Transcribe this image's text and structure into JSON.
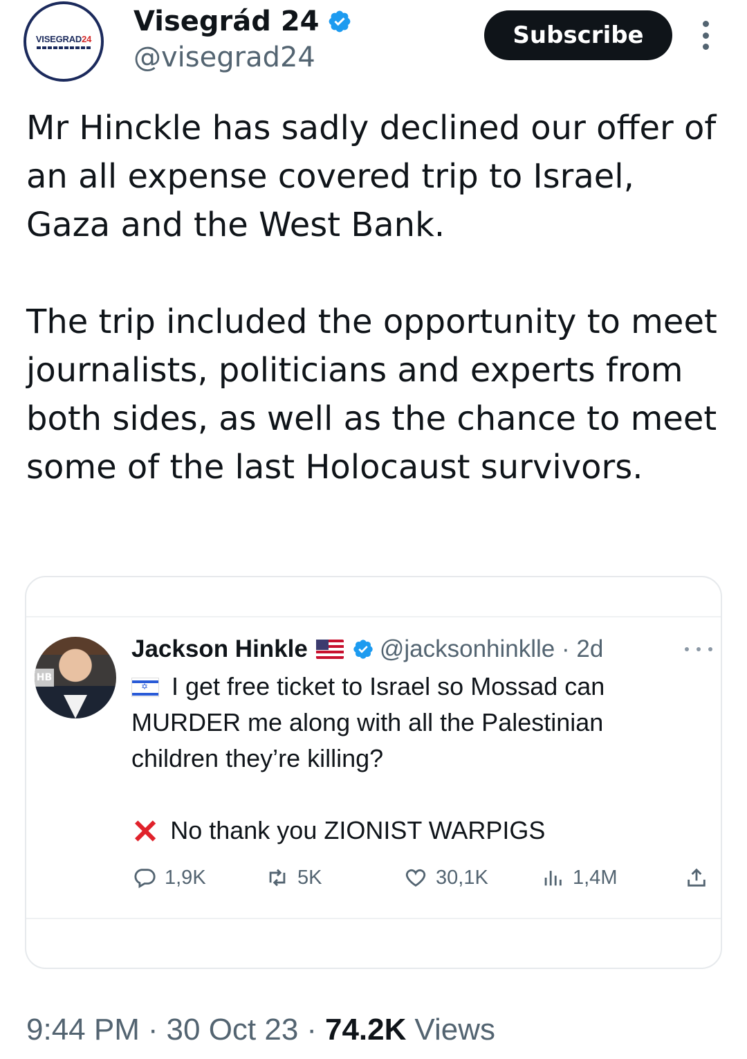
{
  "author": {
    "display_name": "Visegrád 24",
    "handle": "@visegrad24",
    "avatar_logo_text": "VISEGRAD",
    "avatar_logo_num": "24",
    "verified_icon": "verified-badge-icon",
    "verified_color": "#1d9bf0"
  },
  "header": {
    "subscribe_label": "Subscribe",
    "more_icon": "more-vertical-icon"
  },
  "tweet": {
    "paragraphs": [
      "Mr Hinckle has sadly declined our offer of an all expense covered trip to Israel, Gaza and the West Bank.",
      "The trip included the opportunity to meet journalists, politicians and experts from both sides, as well as the chance to meet some of the last Holocaust survivors."
    ]
  },
  "quote": {
    "author_name": "Jackson Hinkle",
    "author_flag_icon": "us-flag-icon",
    "handle_time": "@jacksonhinklle · 2d",
    "avatar_overlay_text": "HB",
    "text_line1": "I get free ticket to Israel so Mossad can MURDER me along with all the Palestinian children they’re killing?",
    "text_line2": "No thank you ZIONIST WARPIGS",
    "text_line1_flag_icon": "israel-flag-icon",
    "text_line2_icon": "red-x-mark-icon",
    "actions": {
      "replies": "1,9K",
      "reposts": "5K",
      "likes": "30,1K",
      "views": "1,4M"
    }
  },
  "footer": {
    "time": "9:44 PM",
    "date": "30 Oct 23",
    "views_count": "74.2K",
    "views_label": "Views",
    "separator": "·"
  },
  "colors": {
    "text_primary": "#0f1419",
    "text_secondary": "#536471",
    "accent_blue": "#1d9bf0",
    "button_bg": "#0f1419",
    "x_red": "#e0222b"
  }
}
